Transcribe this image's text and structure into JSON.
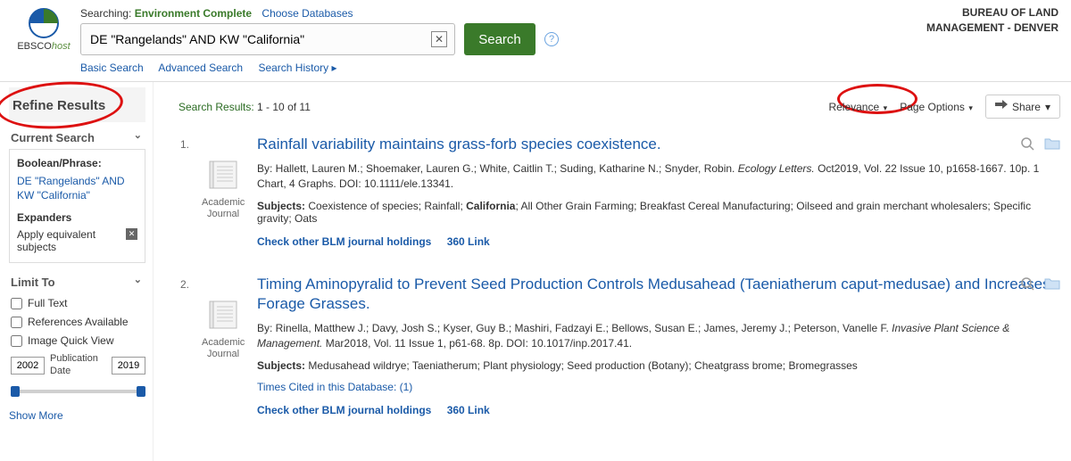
{
  "header": {
    "logo": {
      "brand": "EBSCO",
      "suffix": "host"
    },
    "searching_prefix": "Searching:",
    "database_name": "Environment Complete",
    "choose_db": "Choose Databases",
    "search_value": "DE \"Rangelands\" AND KW \"California\"",
    "search_button": "Search",
    "links": {
      "basic": "Basic Search",
      "advanced": "Advanced Search",
      "history": "Search History"
    },
    "org_line1": "BUREAU OF LAND",
    "org_line2": "MANAGEMENT - DENVER"
  },
  "sidebar": {
    "refine_title": "Refine Results",
    "current_search": "Current Search",
    "boolean_label": "Boolean/Phrase:",
    "boolean_value": "DE \"Rangelands\" AND KW \"California\"",
    "expanders_label": "Expanders",
    "expanders_value": "Apply equivalent subjects",
    "limit_to": "Limit To",
    "limits": [
      "Full Text",
      "References Available",
      "Image Quick View"
    ],
    "date_from": "2002",
    "date_to": "2019",
    "date_label": "Publication Date",
    "show_more": "Show More"
  },
  "results_header": {
    "label": "Search Results:",
    "range": "1 - 10 of 11",
    "sort": "Relevance",
    "page_options": "Page Options",
    "share": "Share"
  },
  "results": [
    {
      "num": "1.",
      "title": "Rainfall variability maintains grass-forb species coexistence.",
      "by_prefix": "By: ",
      "authors": "Hallett, Lauren M.; Shoemaker, Lauren G.; White, Caitlin T.; Suding, Katharine N.; Snyder, Robin. ",
      "journal": "Ecology Letters.",
      "citation": " Oct2019, Vol. 22 Issue 10, p1658-1667. 10p. 1 Chart, 4 Graphs. DOI: 10.1111/ele.13341.",
      "subjects_label": "Subjects: ",
      "subjects_pre": "Coexistence of species; Rainfall; ",
      "subjects_bold": "California",
      "subjects_post": "; All Other Grain Farming; Breakfast Cereal Manufacturing; Oilseed and grain merchant wholesalers; Specific gravity; Oats",
      "check_link": "Check other BLM journal holdings",
      "link360": "360 Link",
      "doc_type": "Academic Journal"
    },
    {
      "num": "2.",
      "title": "Timing Aminopyralid to Prevent Seed Production Controls Medusahead (Taeniatherum caput-medusae) and Increases Forage Grasses.",
      "by_prefix": "By: ",
      "authors": "Rinella, Matthew J.; Davy, Josh S.; Kyser, Guy B.; Mashiri, Fadzayi E.; Bellows, Susan E.; James, Jeremy J.; Peterson, Vanelle F. ",
      "journal": "Invasive Plant Science & Management.",
      "citation": " Mar2018, Vol. 11 Issue 1, p61-68. 8p. DOI: 10.1017/inp.2017.41.",
      "subjects_label": "Subjects: ",
      "subjects_pre": "Medusahead wildrye; Taeniatherum; Plant physiology; Seed production (Botany); Cheatgrass brome; Bromegrasses",
      "subjects_bold": "",
      "subjects_post": "",
      "cited": "Times Cited in this Database: (1)",
      "check_link": "Check other BLM journal holdings",
      "link360": "360 Link",
      "doc_type": "Academic Journal"
    }
  ]
}
